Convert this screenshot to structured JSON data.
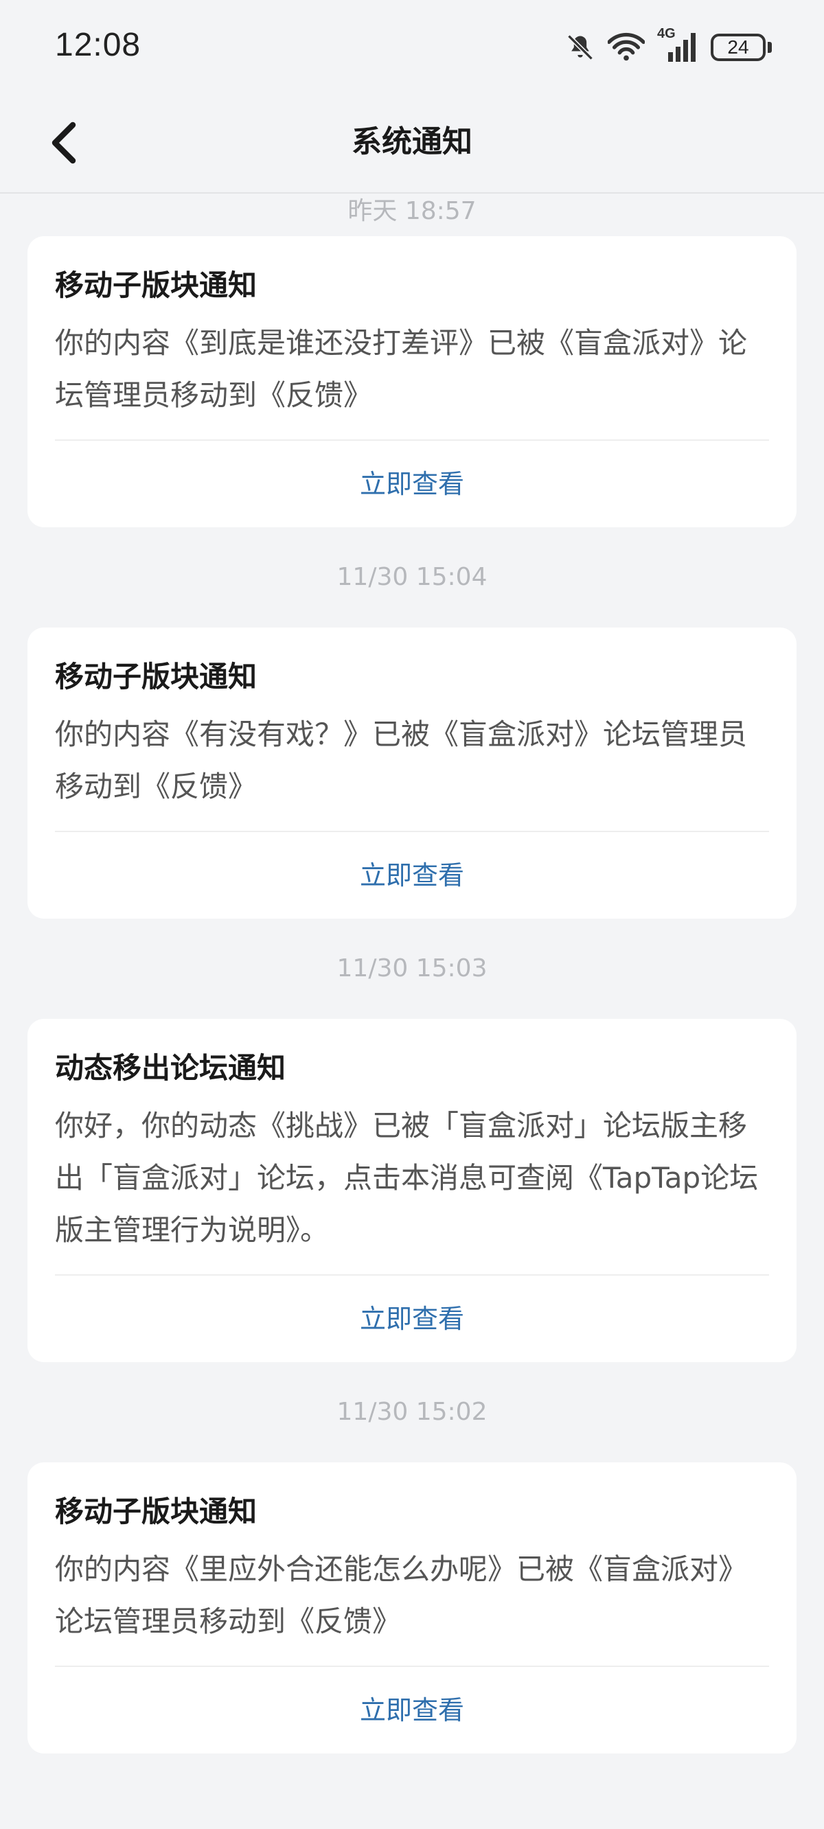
{
  "status_bar": {
    "time": "12:08",
    "network": "4G",
    "battery": "24"
  },
  "header": {
    "title": "系统通知"
  },
  "notifications": [
    {
      "timestamp": "昨天  18:57",
      "title": "移动子版块通知",
      "body": "你的内容《到底是谁还没打差评》已被《盲盒派对》论坛管理员移动到《反馈》",
      "action": "立即查看"
    },
    {
      "timestamp": "11/30  15:04",
      "title": "移动子版块通知",
      "body": "你的内容《有没有戏？》已被《盲盒派对》论坛管理员移动到《反馈》",
      "action": "立即查看"
    },
    {
      "timestamp": "11/30  15:03",
      "title": "动态移出论坛通知",
      "body": "你好，你的动态《挑战》已被「盲盒派对」论坛版主移出「盲盒派对」论坛，点击本消息可查阅《TapTap论坛版主管理行为说明》。",
      "action": "立即查看"
    },
    {
      "timestamp": "11/30  15:02",
      "title": "移动子版块通知",
      "body": "你的内容《里应外合还能怎么办呢》已被《盲盒派对》论坛管理员移动到《反馈》",
      "action": "立即查看"
    }
  ]
}
